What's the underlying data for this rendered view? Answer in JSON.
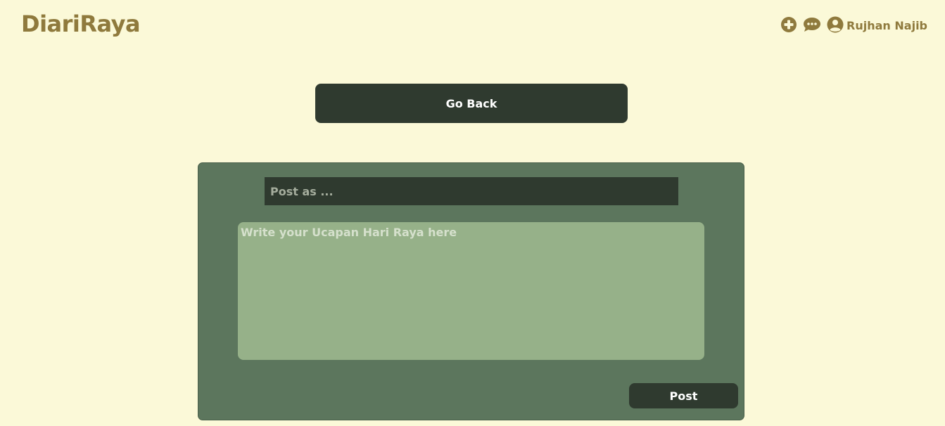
{
  "header": {
    "brand": "DiariRaya",
    "user_name": "Rujhan Najib",
    "icons": [
      "plus-circle-icon",
      "chat-icon",
      "user-circle-icon"
    ]
  },
  "actions": {
    "go_back_label": "Go Back"
  },
  "form": {
    "post_as_placeholder": "Post as ...",
    "post_as_value": "",
    "message_placeholder": "Write your Ucapan Hari Raya here",
    "message_value": "",
    "post_label": "Post"
  },
  "colors": {
    "background": "#fbf9d8",
    "brand": "#8f7a3d",
    "dark_button": "#2f3a2f",
    "card": "#5c765d",
    "textarea": "#96b189"
  }
}
